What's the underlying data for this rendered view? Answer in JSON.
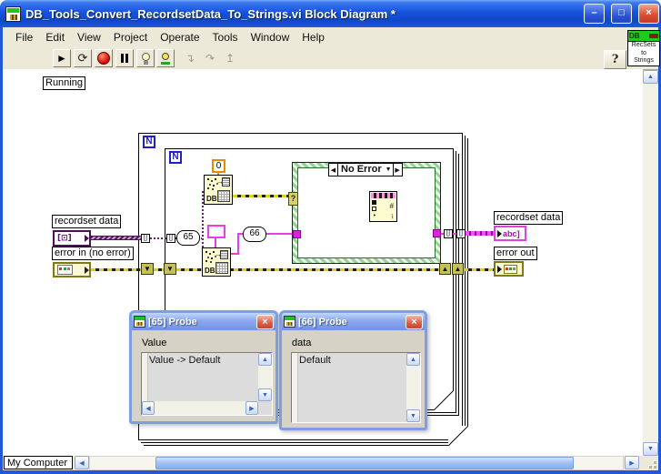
{
  "window": {
    "title": "DB_Tools_Convert_RecordsetData_To_Strings.vi Block Diagram *"
  },
  "menu": {
    "items": [
      "File",
      "Edit",
      "View",
      "Project",
      "Operate",
      "Tools",
      "Window",
      "Help"
    ]
  },
  "toolbar": {
    "help": "?"
  },
  "vi_icon": {
    "header": "DB",
    "line1": "RecSets",
    "line2": "to",
    "line3": "Strings"
  },
  "diagram": {
    "running": "Running",
    "loop_count": "N",
    "zero_const": "0",
    "probe65_id": "65",
    "probe66_id": "66",
    "case_selector": "No Error",
    "selector_terminal": "?",
    "db_label": "DB",
    "tunnel_glyph": "[]",
    "recordset_in_glyph": "[⊡]",
    "recordset_out_glyph": "abc]",
    "labels": {
      "recordset_in": "recordset data",
      "error_in": "error in (no error)",
      "recordset_out": "recordset data",
      "error_out": "error out"
    }
  },
  "probe65": {
    "title": "[65] Probe",
    "field": "Value",
    "value": "Value -> Default"
  },
  "probe66": {
    "title": "[66] Probe",
    "field": "data",
    "value": "Default"
  },
  "statusbar": {
    "context": "My Computer"
  },
  "icons": {
    "minimize": "–",
    "maximize": "□",
    "close": "×",
    "probe_close": "×",
    "sel_left": "◀",
    "sel_right": "▶",
    "sel_drop": "▼",
    "sr_down": "▼",
    "sr_up": "▲",
    "run": "►",
    "continuous": "⟳",
    "step_into": "↴",
    "step_over": "↷",
    "step_out": "↥",
    "scroll_up": "▲",
    "scroll_down": "▼",
    "scroll_left": "◀",
    "scroll_right": "▶",
    "arrow_right": "→"
  },
  "colors": {
    "titlebar_blue": "#1653dd",
    "case_green": "#94d394",
    "string_pink": "#e43ee4",
    "variant_purple": "#6b1f7c",
    "error_olive": "#d9d023",
    "loop_n_blue": "#2020c8"
  }
}
